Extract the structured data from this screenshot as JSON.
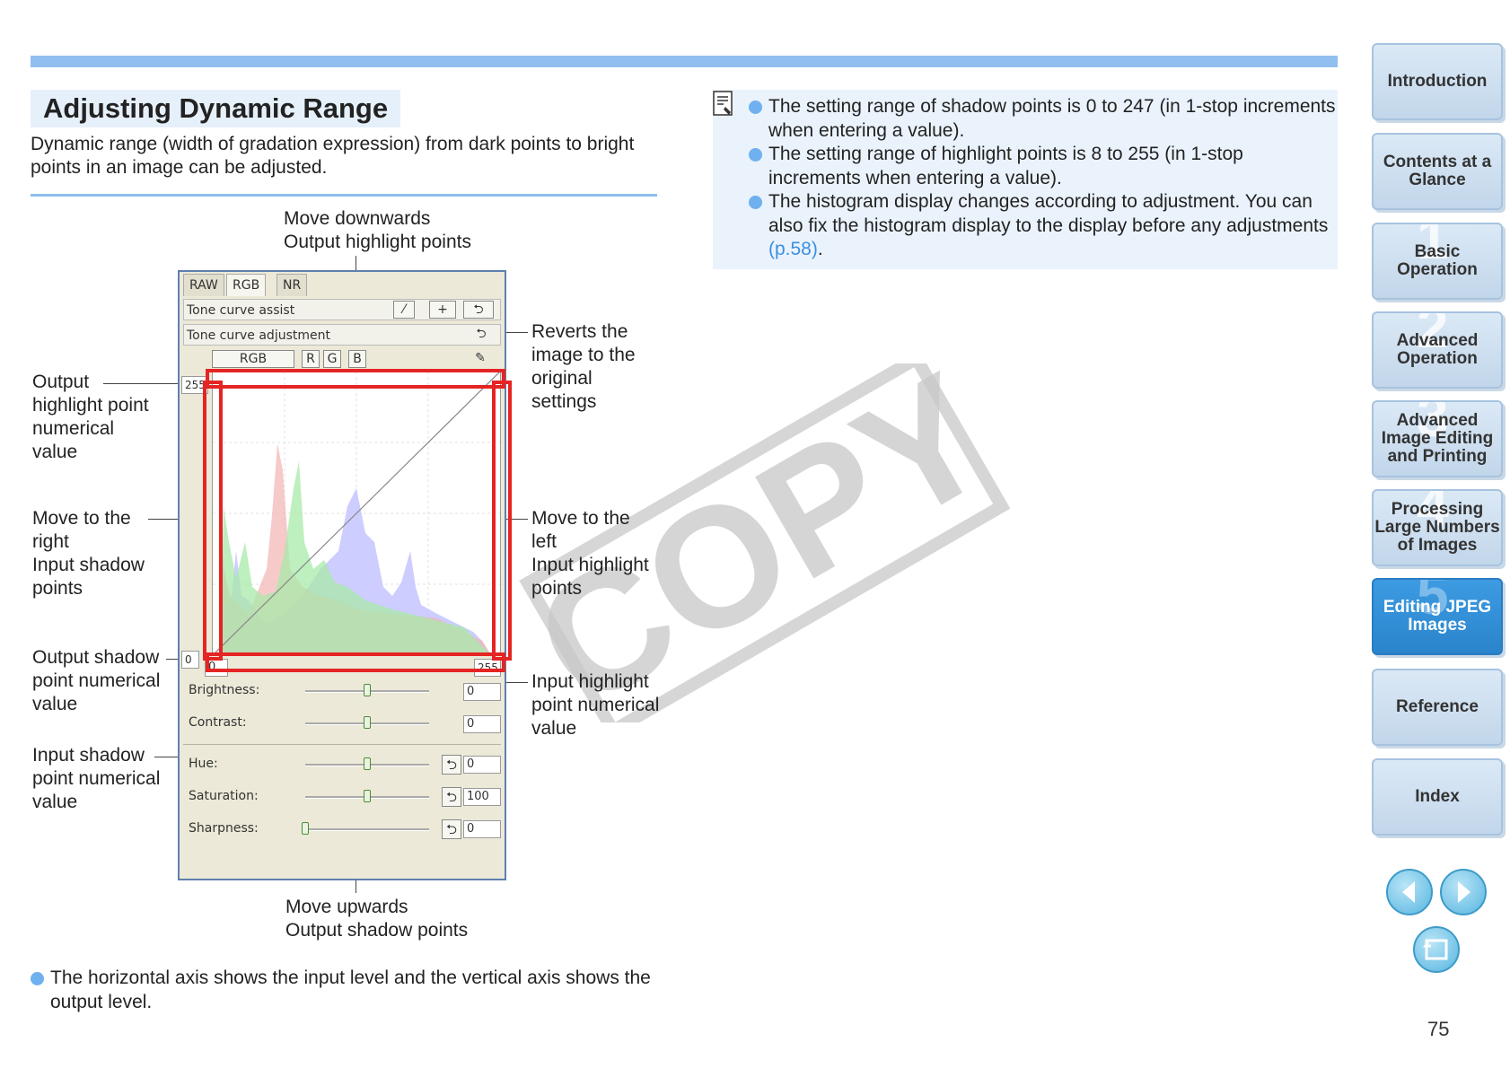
{
  "page": {
    "title": "Adjusting Dynamic Range",
    "intro": "Dynamic range (width of gradation expression) from dark points to bright points in an image can be adjusted.",
    "notes": [
      "The setting range of shadow points is 0 to 247 (in 1-stop increments when entering a value).",
      "The setting range of highlight points is 8 to 255 (in 1-stop increments when entering a value)."
    ],
    "note3_text": "The histogram display changes according to adjustment. You can also fix the histogram display to the display before any adjustments ",
    "note3_link": "(p.58)",
    "note3_end": ".",
    "bottom_note": "The horizontal axis shows the input level and the vertical axis shows the output level.",
    "page_number": "75",
    "watermark": "COPY"
  },
  "callouts": {
    "top": [
      "Move downwards",
      "Output highlight points"
    ],
    "revert": [
      "Reverts the",
      "image to the",
      "original",
      "settings"
    ],
    "output_highlight": [
      "Output",
      "highlight point",
      "numerical",
      "value"
    ],
    "move_right": [
      "Move to the",
      "right",
      "Input shadow",
      "points"
    ],
    "move_left": [
      "Move to the",
      "left",
      "Input highlight",
      "points"
    ],
    "output_shadow": [
      "Output shadow",
      "point numerical",
      "value"
    ],
    "input_highlight": [
      "Input highlight",
      "point numerical",
      "value"
    ],
    "input_shadow": [
      "Input shadow",
      "point numerical",
      "value"
    ],
    "bottom": [
      "Move upwards",
      "Output shadow points"
    ]
  },
  "panel": {
    "tabs": [
      "RAW",
      "RGB",
      "NR"
    ],
    "tone_curve_assist": "Tone curve assist",
    "tone_curve_adjustment": "Tone curve adjustment",
    "channels": [
      "RGB",
      "R",
      "G",
      "B"
    ],
    "y_max": "255",
    "y_min": "0",
    "x_min": "0",
    "x_max": "255",
    "sliders": [
      {
        "label": "Brightness:",
        "value": "0",
        "level": 0.5
      },
      {
        "label": "Contrast:",
        "value": "0",
        "level": 0.5
      },
      {
        "label": "Hue:",
        "value": "0",
        "level": 0.5
      },
      {
        "label": "Saturation:",
        "value": "100",
        "level": 0.5
      },
      {
        "label": "Sharpness:",
        "value": "0",
        "level": 0.0
      }
    ]
  },
  "nav": {
    "tabs": [
      {
        "label": "Introduction",
        "num": ""
      },
      {
        "label": "Contents at a Glance",
        "num": ""
      },
      {
        "label": "Basic Operation",
        "num": "1"
      },
      {
        "label": "Advanced Operation",
        "num": "2"
      },
      {
        "label": "Advanced Image Editing and Printing",
        "num": "3"
      },
      {
        "label": "Processing Large Numbers of Images",
        "num": "4"
      },
      {
        "label": "Editing JPEG Images",
        "num": "5"
      },
      {
        "label": "Reference",
        "num": ""
      },
      {
        "label": "Index",
        "num": ""
      }
    ],
    "active_index": 6
  },
  "colors": {
    "accent": "#90bff0",
    "link": "#3c8fe0",
    "highlight_box": "#e52424",
    "active_tab": "#2a84cc"
  }
}
